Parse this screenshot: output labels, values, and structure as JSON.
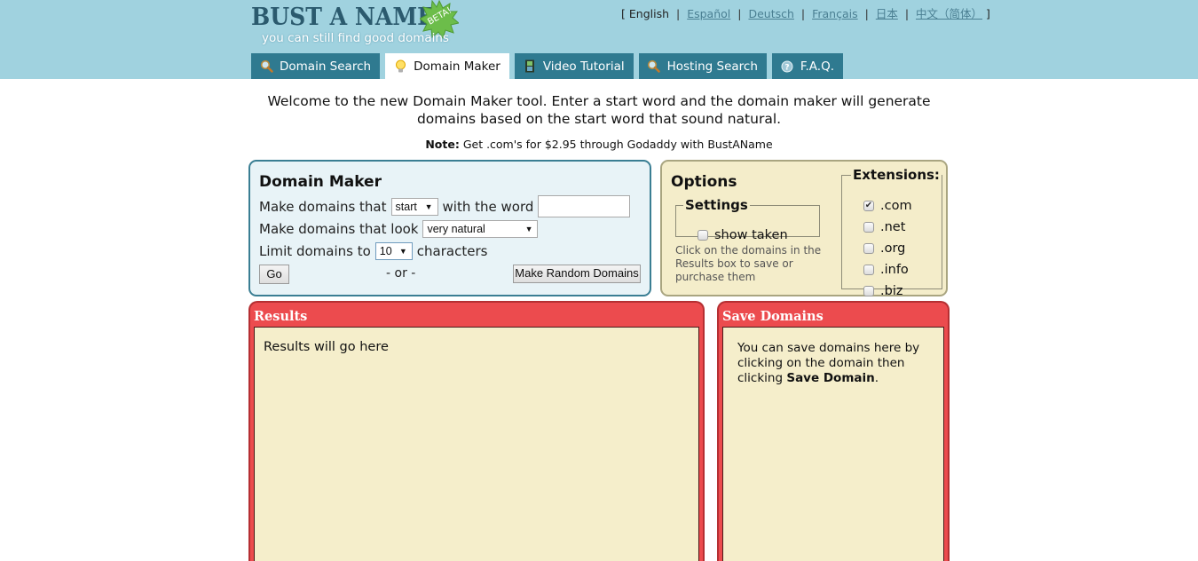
{
  "logo": {
    "title": "BUST A NAME",
    "badge": "BETA!",
    "tagline": "you can still find good domains"
  },
  "languages": {
    "open_bracket": "[",
    "close_bracket": "]",
    "separator": "|",
    "items": [
      {
        "label": "English",
        "current": true
      },
      {
        "label": "Español",
        "current": false
      },
      {
        "label": "Deutsch",
        "current": false
      },
      {
        "label": "Français",
        "current": false
      },
      {
        "label": "日本",
        "current": false
      },
      {
        "label": "中文（简体）",
        "current": false
      }
    ]
  },
  "tabs": [
    {
      "label": "Domain Search",
      "icon": "magnifier-icon",
      "active": false
    },
    {
      "label": "Domain Maker",
      "icon": "lightbulb-icon",
      "active": true
    },
    {
      "label": "Video Tutorial",
      "icon": "film-icon",
      "active": false
    },
    {
      "label": "Hosting Search",
      "icon": "magnifier-icon",
      "active": false
    },
    {
      "label": "F.A.Q.",
      "icon": "help-icon",
      "active": false
    }
  ],
  "intro": {
    "text": "Welcome to the new Domain Maker tool. Enter a start word and the domain maker will generate domains based on the start word that sound natural.",
    "note_label": "Note:",
    "note_text": " Get .com's for $2.95 through Godaddy with BustAName"
  },
  "maker": {
    "title": "Domain Maker",
    "row1_prefix": "Make domains that",
    "position_select": "start",
    "row1_suffix": "with the word",
    "word_value": "",
    "row2_prefix": "Make domains that look",
    "look_select": "very natural",
    "row3_prefix": "Limit domains to",
    "limit_select": "10",
    "row3_suffix": "characters",
    "go_label": "Go",
    "or_label": "- or -",
    "random_label": "Make Random Domains"
  },
  "options": {
    "title": "Options",
    "settings_legend": "Settings",
    "show_taken_label": "show taken",
    "show_taken_checked": false,
    "help_text": "Click on the domains in the Results box to save or purchase them",
    "extensions_legend": "Extensions:",
    "extensions": [
      {
        "label": ".com",
        "checked": true
      },
      {
        "label": ".net",
        "checked": false
      },
      {
        "label": ".org",
        "checked": false
      },
      {
        "label": ".info",
        "checked": false
      },
      {
        "label": ".biz",
        "checked": false
      }
    ]
  },
  "results": {
    "title": "Results",
    "placeholder": "Results will go here"
  },
  "save": {
    "title": "Save Domains",
    "text_before": "You can save domains here by clicking on the domain then clicking ",
    "text_bold": "Save Domain",
    "text_after": "."
  },
  "colors": {
    "header_bg": "#a0d2df",
    "tab_bg": "#2f7a90",
    "maker_bg": "#e8f3f7",
    "maker_border": "#3a7e93",
    "options_bg": "#f4edca",
    "red_panel": "#ec4b4e",
    "panel_body": "#f5eecb"
  }
}
